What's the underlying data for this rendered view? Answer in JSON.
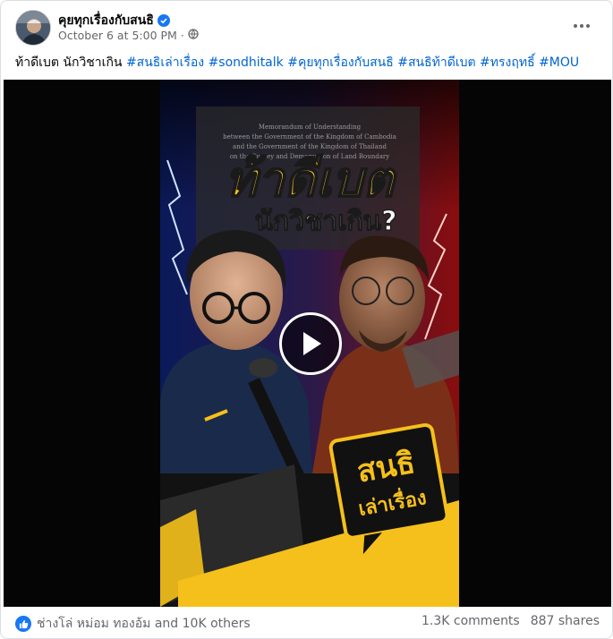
{
  "post": {
    "page_name": "คุยทุกเรื่องกับสนธิ",
    "timestamp": "October 6 at 5:00 PM",
    "privacy_separator": "·",
    "caption_text": "ท้าดีเบต นักวิชาเกิน ",
    "hashtags": [
      "#สนธิเล่าเรื่อง",
      "#sondhitalk",
      "#คุยทุกเรื่องกับสนธิ",
      "#สนธิท้าดีเบต",
      "#ทรงฤทธิ์",
      "#MOU"
    ]
  },
  "video": {
    "title_line1": "ท้าดีเบต",
    "title_line2": "นักวิชาเกิน?",
    "document_lines": [
      "Memorandum of Understanding",
      "between the Government of the Kingdom of Cambodia",
      "and the Government of the Kingdom of Thailand",
      "on the Survey and Demarcation of Land Boundary"
    ],
    "badge_line1": "สนธิ",
    "badge_line2": "เล่าเรื่อง"
  },
  "footer": {
    "reactions_text": "ช่างโล่ หม่อม ทองอ้ม and 10K others",
    "comments": "1.3K comments",
    "shares": "887 shares"
  },
  "colors": {
    "link": "#0064d1",
    "brand_blue": "#1877f2",
    "title_yellow": "#f7c21a",
    "muted": "#65676b"
  },
  "icons": {
    "verified": "verified-badge-icon",
    "privacy": "globe-icon",
    "more": "more-horizontal-icon",
    "play": "play-icon",
    "like": "like-icon"
  }
}
